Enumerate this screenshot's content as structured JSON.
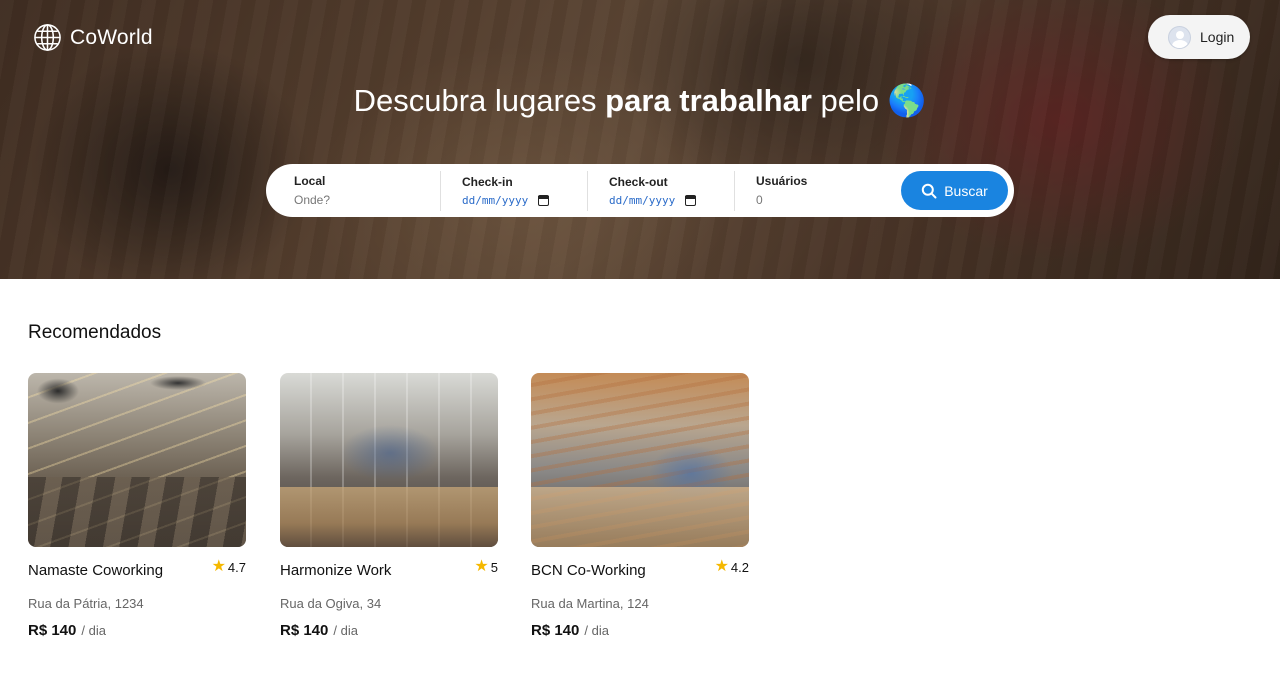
{
  "header": {
    "logo_text": "CoWorld",
    "login_label": "Login"
  },
  "hero": {
    "headline_part1": "Descubra lugares ",
    "headline_bold": "para trabalhar",
    "headline_part2": " pelo ",
    "headline_emoji": "🌎"
  },
  "search": {
    "local_label": "Local",
    "local_placeholder": "Onde?",
    "checkin_label": "Check-in",
    "checkin_placeholder": "dd/mm/yyyy",
    "checkout_label": "Check-out",
    "checkout_placeholder": "dd/mm/yyyy",
    "users_label": "Usuários",
    "users_value": "0",
    "button_label": "Buscar",
    "button_color": "#1a84e0"
  },
  "recommended": {
    "title": "Recomendados",
    "cards": [
      {
        "name": "Namaste Coworking",
        "rating": "4.7",
        "address": "Rua da Pátria, 1234",
        "price": "R$ 140",
        "unit": "/ dia"
      },
      {
        "name": "Harmonize Work",
        "rating": "5",
        "address": "Rua da Ogiva, 34",
        "price": "R$ 140",
        "unit": "/ dia"
      },
      {
        "name": "BCN Co-Working",
        "rating": "4.2",
        "address": "Rua da Martina, 124",
        "price": "R$ 140",
        "unit": "/ dia"
      }
    ]
  }
}
